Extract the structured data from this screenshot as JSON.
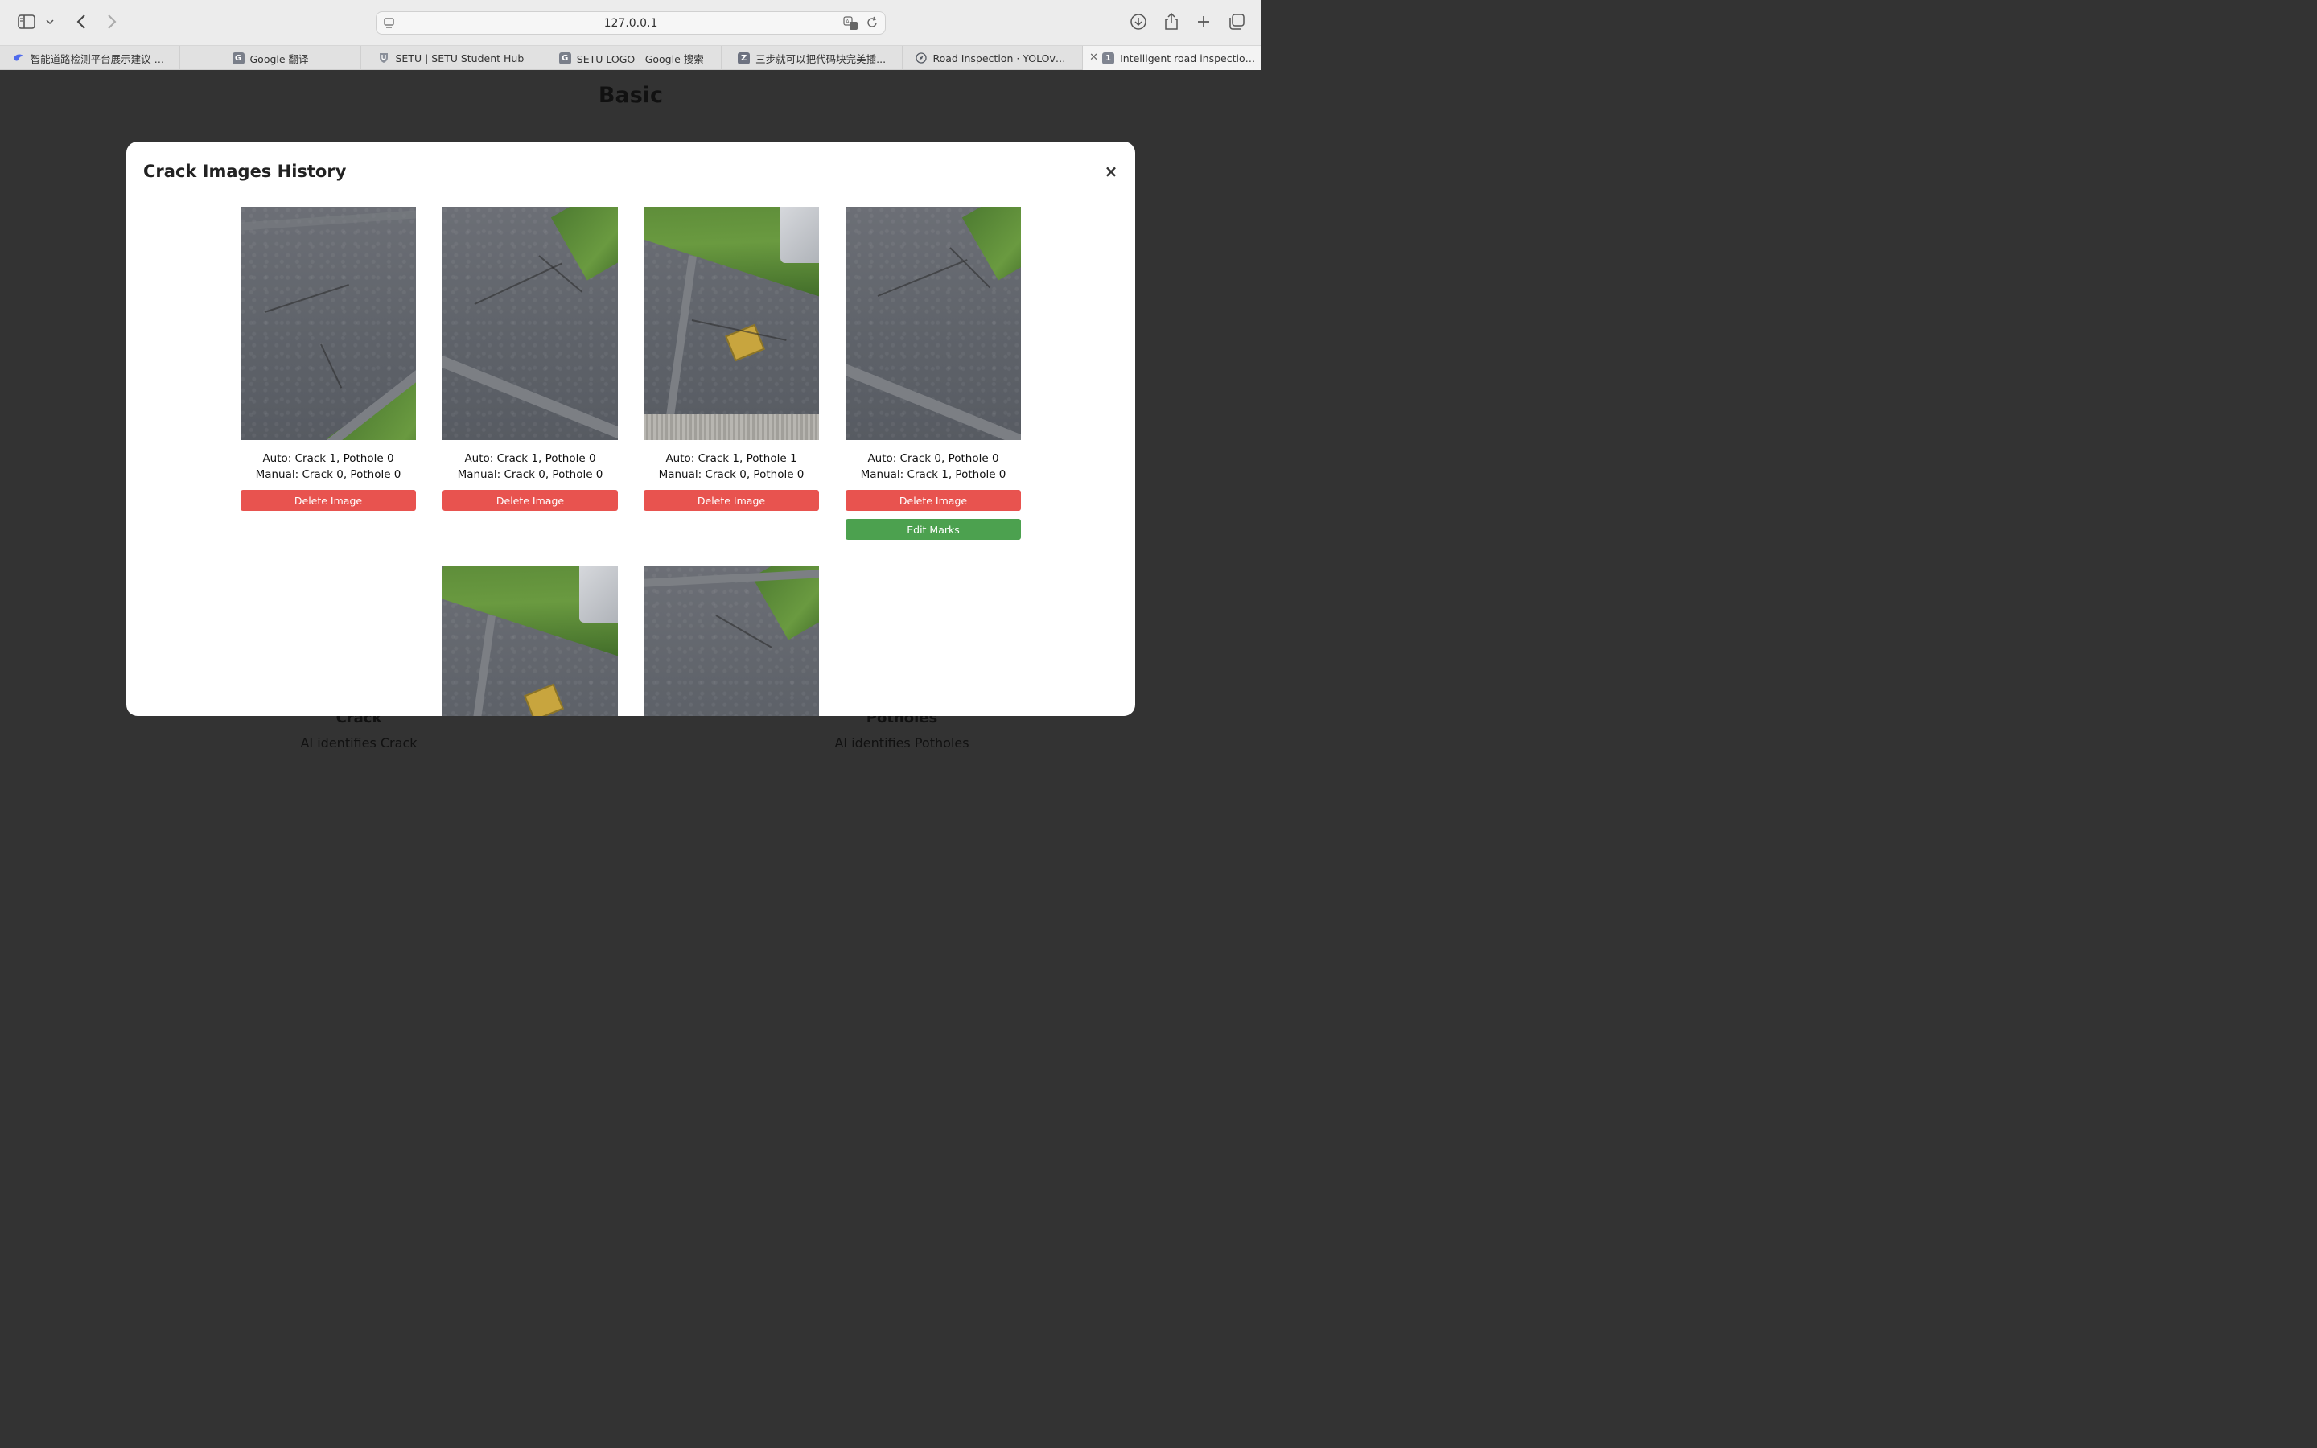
{
  "browser": {
    "address": "127.0.0.1",
    "tabs": [
      {
        "title": "智能道路检测平台展示建议 -...",
        "favicon_color": "#4f6bed"
      },
      {
        "title": "Google 翻译",
        "favicon_color": "#7a7f8a",
        "favicon_letter": "G"
      },
      {
        "title": "SETU | SETU Student Hub",
        "favicon_color": "#8a8f99"
      },
      {
        "title": "SETU LOGO - Google 搜索",
        "favicon_color": "#7a7f8a",
        "favicon_letter": "G"
      },
      {
        "title": "三步就可以把代码块完美插...",
        "favicon_color": "#6d7280",
        "favicon_letter": "Z"
      },
      {
        "title": "Road Inspection · YOLOv8...",
        "favicon_color": "#555a63"
      },
      {
        "title": "Intelligent road inspection p...",
        "favicon_color": "#7f8490",
        "favicon_letter": "1",
        "active": true
      }
    ]
  },
  "page": {
    "title": "Basic",
    "features": [
      {
        "title": "Crack",
        "desc": "AI identifies Crack"
      },
      {
        "title": "Potholes",
        "desc": "AI identifies Potholes"
      }
    ]
  },
  "modal": {
    "title": "Crack Images History",
    "close_label": "×",
    "delete_label": "Delete Image",
    "edit_label": "Edit Marks",
    "cards": [
      {
        "auto": "Auto: Crack 1, Pothole 0",
        "manual": "Manual: Crack 0, Pothole 0",
        "scene": "asphalt-grass-bottom"
      },
      {
        "auto": "Auto: Crack 1, Pothole 0",
        "manual": "Manual: Crack 0, Pothole 0",
        "scene": "asphalt-grass-top"
      },
      {
        "auto": "Auto: Crack 1, Pothole 1",
        "manual": "Manual: Crack 0, Pothole 0",
        "scene": "kerb-plate-car"
      },
      {
        "auto": "Auto: Crack 0, Pothole 0",
        "manual": "Manual: Crack 1, Pothole 0",
        "scene": "asphalt-grass-top",
        "editable": true
      },
      {
        "scene": "kerb-plate-car"
      },
      {
        "scene": "asphalt-grass-top"
      }
    ]
  },
  "colors": {
    "delete_button": "#e8534f",
    "edit_button": "#4ca14f",
    "overlay": "#333333",
    "modal_bg": "#ffffff"
  }
}
